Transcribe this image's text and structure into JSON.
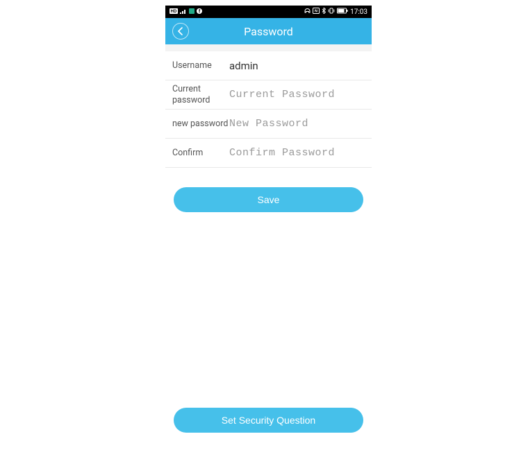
{
  "statusbar": {
    "time": "17:03"
  },
  "header": {
    "title": "Password"
  },
  "form": {
    "username_label": "Username",
    "username_value": "admin",
    "current_label": "Current password",
    "current_placeholder": "Current Password",
    "new_label": "new password",
    "new_placeholder": "New Password",
    "confirm_label": "Confirm",
    "confirm_placeholder": "Confirm Password"
  },
  "buttons": {
    "save": "Save",
    "security": "Set Security Question"
  },
  "colors": {
    "accent": "#35b3e6",
    "button": "#46c0ea"
  }
}
